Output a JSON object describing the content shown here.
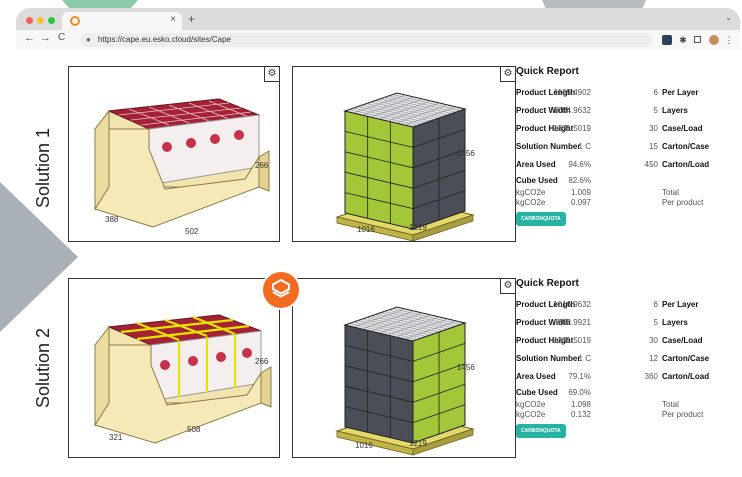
{
  "browser": {
    "tab_close": "×",
    "new_tab": "+",
    "tab_menu": "⌄",
    "url": "https://cape.eu.esko.cloud/sites/Cape",
    "back": "←",
    "forward": "→",
    "reload": "C"
  },
  "solutions": [
    {
      "label": "Solution 1",
      "case_dims": {
        "length": "502",
        "width": "388",
        "height": "266"
      },
      "pallet_dims": {
        "length": "1016",
        "width": "1219",
        "height": "1456"
      },
      "report": {
        "title": "Quick Report",
        "rows": [
          {
            "label": "Product Length",
            "value": "1165.4902",
            "n": "6",
            "unit": "Per Layer"
          },
          {
            "label": "Product Width",
            "value": "1004.9632",
            "n": "5",
            "unit": "Layers"
          },
          {
            "label": "Product Height",
            "value": "1331.5019",
            "n": "30",
            "unit": "Case/Load"
          },
          {
            "label": "Solution Number",
            "value": "1 C",
            "n": "15",
            "unit": "Carton/Case"
          },
          {
            "label": "Area Used",
            "value": "94.6%",
            "n": "450",
            "unit": "Carton/Load"
          },
          {
            "label": "Cube Used",
            "value": "82.6%",
            "n": "",
            "unit": ""
          }
        ],
        "co2": [
          {
            "label": "kgCO2e",
            "value": "1.009",
            "unit": "Total"
          },
          {
            "label": "kgCO2e",
            "value": "0.097",
            "unit": "Per product"
          }
        ],
        "badge": "CARBONQUOTA"
      }
    },
    {
      "label": "Solution 2",
      "case_dims": {
        "length": "508",
        "width": "321",
        "height": "266"
      },
      "pallet_dims": {
        "length": "1016",
        "width": "1219",
        "height": "1456"
      },
      "report": {
        "title": "Quick Report",
        "rows": [
          {
            "label": "Product Length",
            "value": "1016.9632",
            "n": "6",
            "unit": "Per Layer"
          },
          {
            "label": "Product Width",
            "value": "962.9921",
            "n": "5",
            "unit": "Layers"
          },
          {
            "label": "Product Height",
            "value": "1331.5019",
            "n": "30",
            "unit": "Case/Load"
          },
          {
            "label": "Solution Number",
            "value": "1 C",
            "n": "12",
            "unit": "Carton/Case"
          },
          {
            "label": "Area Used",
            "value": "79.1%",
            "n": "360",
            "unit": "Carton/Load"
          },
          {
            "label": "Cube Used",
            "value": "69.0%",
            "n": "",
            "unit": ""
          }
        ],
        "co2": [
          {
            "label": "kgCO2e",
            "value": "1.098",
            "unit": "Total"
          },
          {
            "label": "kgCO2e",
            "value": "0.132",
            "unit": "Per product"
          }
        ],
        "badge": "CARBONQUOTA"
      }
    }
  ],
  "colors": {
    "accent": "#f26b21",
    "box_green": "#a4c639",
    "box_dark": "#4a4f57",
    "carton": "#f5e9b8",
    "product_red": "#b3243a",
    "badge": "#27b3a4"
  },
  "icons": {
    "gear": "⚙",
    "lock": "🔒"
  }
}
